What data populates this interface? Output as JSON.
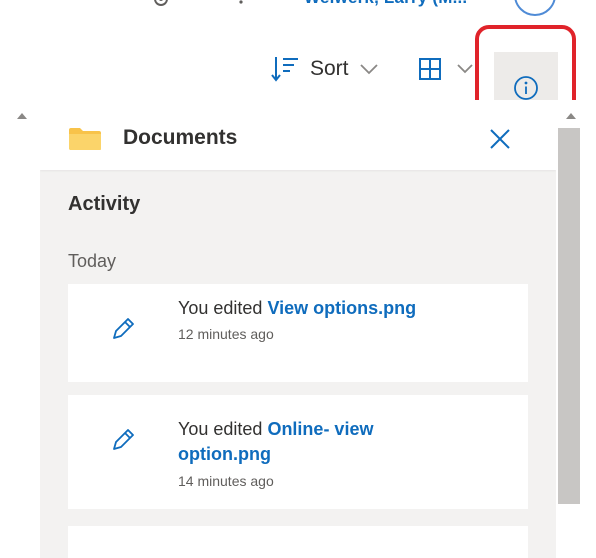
{
  "header": {
    "user_name": "Weiwerk, Larry (M..."
  },
  "toolbar": {
    "sort_label": "Sort",
    "sort_icon": "sort-icon",
    "view_icon": "grid-view-icon",
    "info_icon": "info-icon",
    "highlight_color": "#e0232a"
  },
  "panel": {
    "folder_icon": "folder-icon",
    "title": "Documents",
    "close_icon": "close-icon",
    "section_title": "Activity",
    "day_label": "Today",
    "activities": [
      {
        "icon": "pencil-icon",
        "verb": "You edited",
        "file": "View options.png",
        "time": "12 minutes ago"
      },
      {
        "icon": "pencil-icon",
        "verb": "You edited",
        "file": "Online- view option.png",
        "time": "14 minutes ago"
      }
    ]
  },
  "colors": {
    "accent": "#0f6cbd",
    "folder": "#f8c34a",
    "panel_bg": "#f3f2f1"
  }
}
